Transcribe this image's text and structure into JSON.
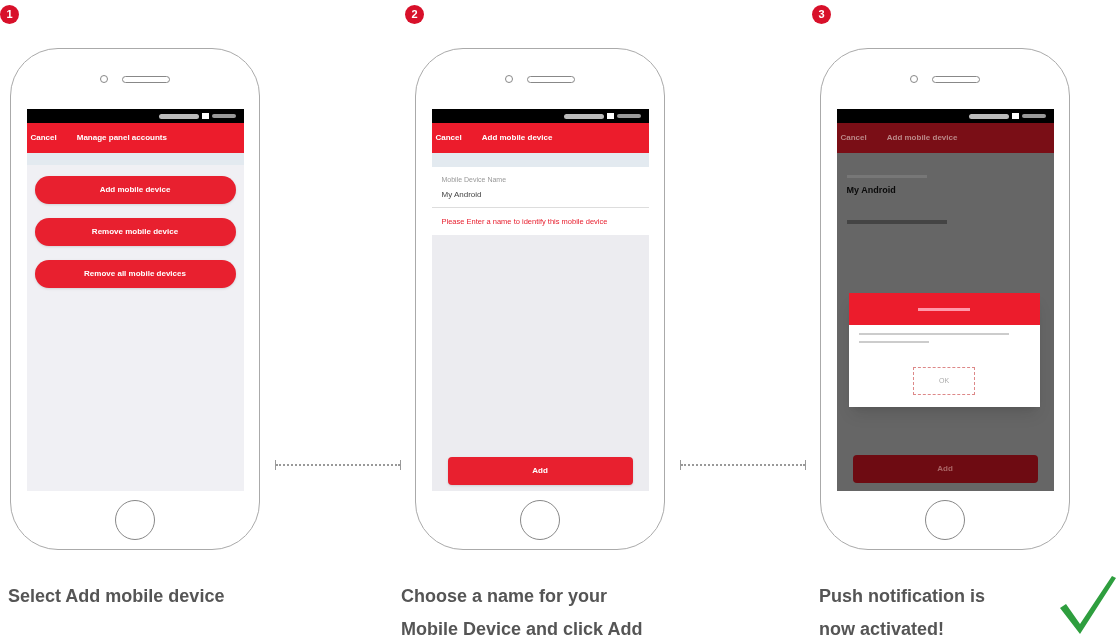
{
  "steps": [
    {
      "number": "1",
      "caption_lines": [
        "Select Add mobile device"
      ],
      "screen": {
        "kind": "menu",
        "header": {
          "left": "Cancel",
          "title": "Manage panel accounts"
        },
        "buttons": [
          "Add mobile device",
          "Remove mobile device",
          "Remove all mobile devices"
        ]
      }
    },
    {
      "number": "2",
      "caption_lines": [
        "Choose a name for your",
        "Mobile Device and click Add"
      ],
      "screen": {
        "kind": "form",
        "header": {
          "left": "Cancel",
          "title": "Add mobile device"
        },
        "field_label": "Mobile Device Name",
        "field_value": "My Android",
        "hint": "Please Enter a name to identify this mobile device",
        "action": "Add"
      }
    },
    {
      "number": "3",
      "caption_lines": [
        "Push notification is",
        "now activated!"
      ],
      "screen": {
        "kind": "dialog",
        "header": {
          "left": "Cancel",
          "title": "Add mobile device"
        },
        "field_value": "My Android",
        "dialog_button": "OK",
        "action": "Add"
      }
    }
  ],
  "done_mark": true
}
